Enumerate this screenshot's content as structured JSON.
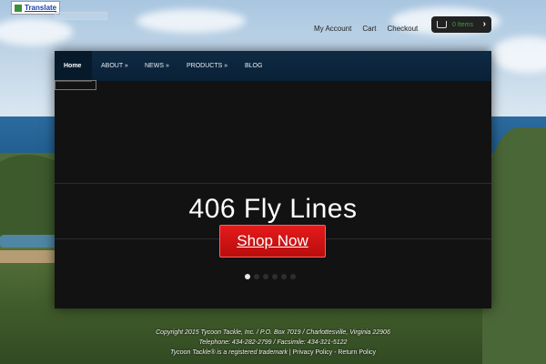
{
  "translate": {
    "label": "Translate"
  },
  "top_nav": {
    "links": [
      "My Account",
      "Cart",
      "Checkout"
    ],
    "cart_summary": "0 Items"
  },
  "menu": {
    "items": [
      "Home",
      "ABOUT »",
      "NEWS »",
      "PRODUCTS »",
      "BLOG"
    ]
  },
  "slide": {
    "title": "406 Fly Lines",
    "button": "Shop Now",
    "dot_count": 6,
    "active_dot": 1
  },
  "footer": {
    "line1": "Copyright 2015 Tycoon Tackle, Inc. / P.O. Box 7019 / Charlottesville, Virginia 22906",
    "line2": "Telephone: 434-282-2799 / Facsimile: 434-321-5122",
    "line3_prefix": "Tycoon Tackle® is a registered trademark | ",
    "privacy": "Privacy Policy",
    "separator": " - ",
    "returns": "Return Policy"
  },
  "colors": {
    "accent": "#cc1111",
    "menu_bg": "#0e2a44",
    "cart_text": "#3aa33a"
  },
  "icons": {
    "cart": "cart-icon",
    "chevron": "chevron-right-icon",
    "translate": "google-translate-icon"
  }
}
